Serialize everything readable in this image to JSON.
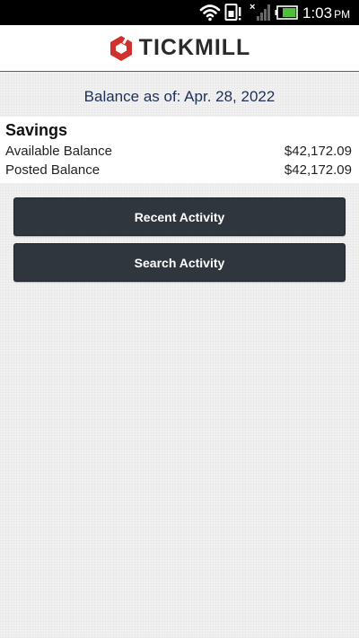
{
  "status_bar": {
    "time": "1:03",
    "ampm": "PM",
    "icons": [
      "wifi-icon",
      "sim-alert-icon",
      "cell-signal-icon",
      "battery-icon"
    ]
  },
  "header": {
    "brand_name": "TICKMILL",
    "logo_icon": "tickmill-logo-icon",
    "brand_color": "#d0312d"
  },
  "balance_date": "Balance as of: Apr. 28, 2022",
  "account": {
    "name": "Savings",
    "rows": [
      {
        "label": "Available Balance",
        "value": "$42,172.09"
      },
      {
        "label": "Posted Balance",
        "value": "$42,172.09"
      }
    ]
  },
  "actions": {
    "recent_activity": "Recent Activity",
    "search_activity": "Search Activity"
  },
  "colors": {
    "header_rule": "#c9322f",
    "button_bg": "#2f363d",
    "date_text": "#1f2f55",
    "page_bg": "#f1f1f1"
  }
}
